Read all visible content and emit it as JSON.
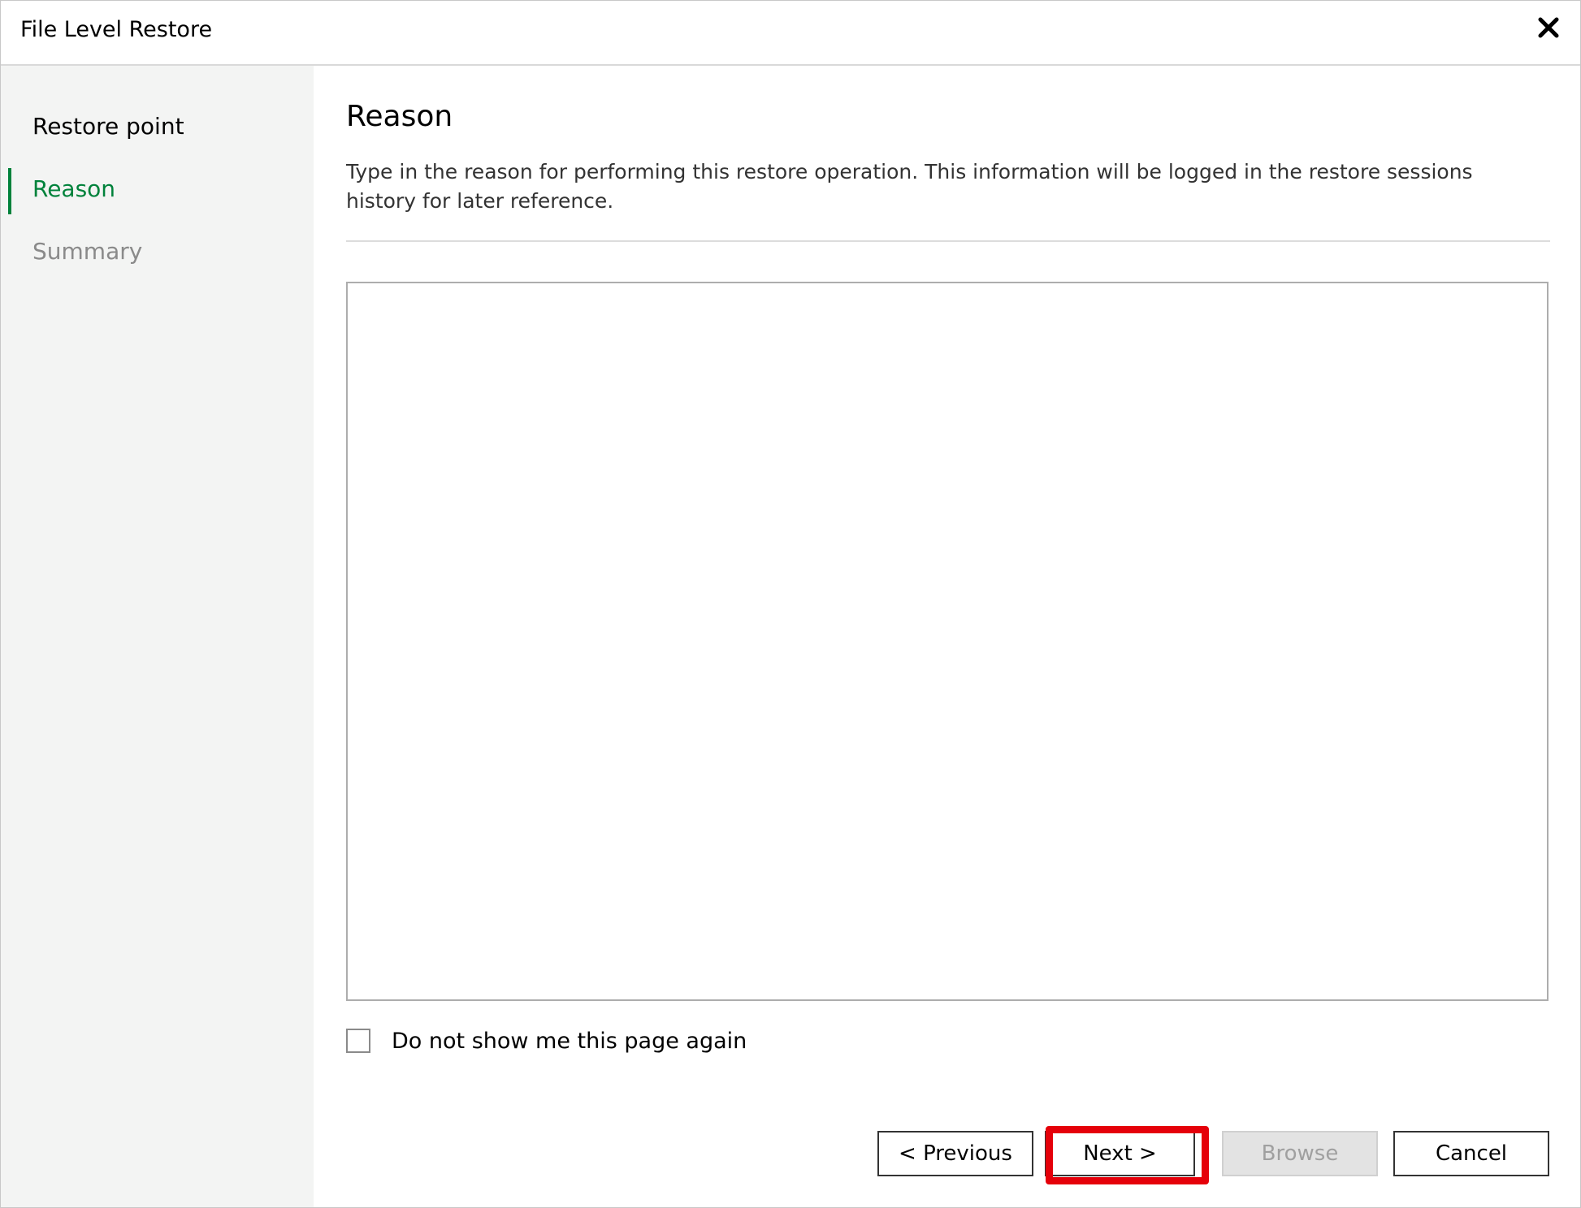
{
  "window": {
    "title": "File Level Restore",
    "close_icon": "close-icon"
  },
  "sidebar": {
    "items": [
      {
        "label": "Restore point",
        "state": "done"
      },
      {
        "label": "Reason",
        "state": "active"
      },
      {
        "label": "Summary",
        "state": "pending"
      }
    ],
    "active_color": "#00823b"
  },
  "main": {
    "title": "Reason",
    "description": "Type in the reason for performing this restore operation. This information will be logged in the restore sessions history for later reference.",
    "reason_value": "",
    "checkbox": {
      "label": "Do not show me this page again",
      "checked": false
    }
  },
  "buttons": {
    "previous": "< Previous",
    "next": "Next >",
    "browse": "Browse",
    "cancel": "Cancel"
  },
  "highlight": {
    "target": "next-button",
    "color": "#e5000a"
  }
}
